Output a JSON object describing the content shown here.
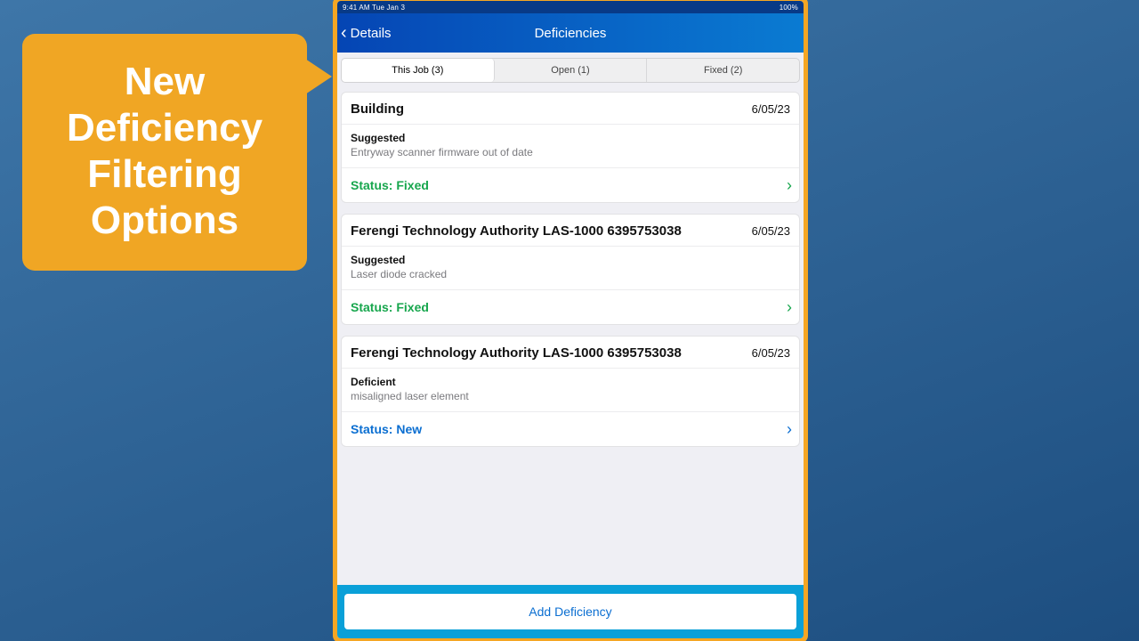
{
  "callout": {
    "line1": "New",
    "line2": "Deficiency",
    "line3": "Filtering",
    "line4": "Options"
  },
  "statusbar": {
    "left": "9:41 AM   Tue Jan 3",
    "right": "100%"
  },
  "nav": {
    "back_label": "Details",
    "title": "Deficiencies"
  },
  "segmented": {
    "tab0": "This Job (3)",
    "tab1": "Open (1)",
    "tab2": "Fixed (2)"
  },
  "cards": [
    {
      "title": "Building",
      "date": "6/05/23",
      "severity": "Suggested",
      "description": "Entryway scanner firmware out of date",
      "status_label": "Status: Fixed",
      "status_kind": "fixed"
    },
    {
      "title": "Ferengi Technology Authority LAS-1000 6395753038",
      "date": "6/05/23",
      "severity": "Suggested",
      "description": "Laser diode cracked",
      "status_label": "Status: Fixed",
      "status_kind": "fixed"
    },
    {
      "title": "Ferengi Technology Authority LAS-1000 6395753038",
      "date": "6/05/23",
      "severity": "Deficient",
      "description": "misaligned laser element",
      "status_label": "Status: New",
      "status_kind": "new"
    }
  ],
  "bottom": {
    "add_label": "Add Deficiency"
  }
}
